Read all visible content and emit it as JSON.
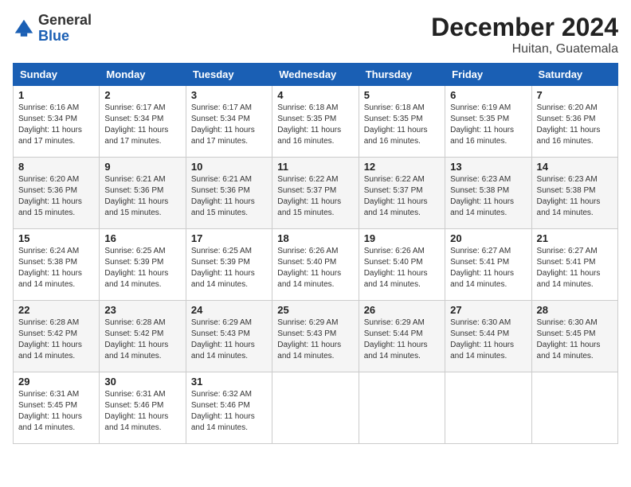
{
  "header": {
    "logo_general": "General",
    "logo_blue": "Blue",
    "month_title": "December 2024",
    "location": "Huitan, Guatemala"
  },
  "calendar": {
    "days_of_week": [
      "Sunday",
      "Monday",
      "Tuesday",
      "Wednesday",
      "Thursday",
      "Friday",
      "Saturday"
    ],
    "weeks": [
      [
        {
          "day": "",
          "info": ""
        },
        {
          "day": "2",
          "info": "Sunrise: 6:17 AM\nSunset: 5:34 PM\nDaylight: 11 hours\nand 17 minutes."
        },
        {
          "day": "3",
          "info": "Sunrise: 6:17 AM\nSunset: 5:34 PM\nDaylight: 11 hours\nand 17 minutes."
        },
        {
          "day": "4",
          "info": "Sunrise: 6:18 AM\nSunset: 5:35 PM\nDaylight: 11 hours\nand 16 minutes."
        },
        {
          "day": "5",
          "info": "Sunrise: 6:18 AM\nSunset: 5:35 PM\nDaylight: 11 hours\nand 16 minutes."
        },
        {
          "day": "6",
          "info": "Sunrise: 6:19 AM\nSunset: 5:35 PM\nDaylight: 11 hours\nand 16 minutes."
        },
        {
          "day": "7",
          "info": "Sunrise: 6:20 AM\nSunset: 5:36 PM\nDaylight: 11 hours\nand 16 minutes."
        }
      ],
      [
        {
          "day": "8",
          "info": "Sunrise: 6:20 AM\nSunset: 5:36 PM\nDaylight: 11 hours\nand 15 minutes."
        },
        {
          "day": "9",
          "info": "Sunrise: 6:21 AM\nSunset: 5:36 PM\nDaylight: 11 hours\nand 15 minutes."
        },
        {
          "day": "10",
          "info": "Sunrise: 6:21 AM\nSunset: 5:36 PM\nDaylight: 11 hours\nand 15 minutes."
        },
        {
          "day": "11",
          "info": "Sunrise: 6:22 AM\nSunset: 5:37 PM\nDaylight: 11 hours\nand 15 minutes."
        },
        {
          "day": "12",
          "info": "Sunrise: 6:22 AM\nSunset: 5:37 PM\nDaylight: 11 hours\nand 14 minutes."
        },
        {
          "day": "13",
          "info": "Sunrise: 6:23 AM\nSunset: 5:38 PM\nDaylight: 11 hours\nand 14 minutes."
        },
        {
          "day": "14",
          "info": "Sunrise: 6:23 AM\nSunset: 5:38 PM\nDaylight: 11 hours\nand 14 minutes."
        }
      ],
      [
        {
          "day": "15",
          "info": "Sunrise: 6:24 AM\nSunset: 5:38 PM\nDaylight: 11 hours\nand 14 minutes."
        },
        {
          "day": "16",
          "info": "Sunrise: 6:25 AM\nSunset: 5:39 PM\nDaylight: 11 hours\nand 14 minutes."
        },
        {
          "day": "17",
          "info": "Sunrise: 6:25 AM\nSunset: 5:39 PM\nDaylight: 11 hours\nand 14 minutes."
        },
        {
          "day": "18",
          "info": "Sunrise: 6:26 AM\nSunset: 5:40 PM\nDaylight: 11 hours\nand 14 minutes."
        },
        {
          "day": "19",
          "info": "Sunrise: 6:26 AM\nSunset: 5:40 PM\nDaylight: 11 hours\nand 14 minutes."
        },
        {
          "day": "20",
          "info": "Sunrise: 6:27 AM\nSunset: 5:41 PM\nDaylight: 11 hours\nand 14 minutes."
        },
        {
          "day": "21",
          "info": "Sunrise: 6:27 AM\nSunset: 5:41 PM\nDaylight: 11 hours\nand 14 minutes."
        }
      ],
      [
        {
          "day": "22",
          "info": "Sunrise: 6:28 AM\nSunset: 5:42 PM\nDaylight: 11 hours\nand 14 minutes."
        },
        {
          "day": "23",
          "info": "Sunrise: 6:28 AM\nSunset: 5:42 PM\nDaylight: 11 hours\nand 14 minutes."
        },
        {
          "day": "24",
          "info": "Sunrise: 6:29 AM\nSunset: 5:43 PM\nDaylight: 11 hours\nand 14 minutes."
        },
        {
          "day": "25",
          "info": "Sunrise: 6:29 AM\nSunset: 5:43 PM\nDaylight: 11 hours\nand 14 minutes."
        },
        {
          "day": "26",
          "info": "Sunrise: 6:29 AM\nSunset: 5:44 PM\nDaylight: 11 hours\nand 14 minutes."
        },
        {
          "day": "27",
          "info": "Sunrise: 6:30 AM\nSunset: 5:44 PM\nDaylight: 11 hours\nand 14 minutes."
        },
        {
          "day": "28",
          "info": "Sunrise: 6:30 AM\nSunset: 5:45 PM\nDaylight: 11 hours\nand 14 minutes."
        }
      ],
      [
        {
          "day": "29",
          "info": "Sunrise: 6:31 AM\nSunset: 5:45 PM\nDaylight: 11 hours\nand 14 minutes."
        },
        {
          "day": "30",
          "info": "Sunrise: 6:31 AM\nSunset: 5:46 PM\nDaylight: 11 hours\nand 14 minutes."
        },
        {
          "day": "31",
          "info": "Sunrise: 6:32 AM\nSunset: 5:46 PM\nDaylight: 11 hours\nand 14 minutes."
        },
        {
          "day": "",
          "info": ""
        },
        {
          "day": "",
          "info": ""
        },
        {
          "day": "",
          "info": ""
        },
        {
          "day": "",
          "info": ""
        }
      ]
    ],
    "week1_day1": {
      "day": "1",
      "info": "Sunrise: 6:16 AM\nSunset: 5:34 PM\nDaylight: 11 hours\nand 17 minutes."
    }
  }
}
